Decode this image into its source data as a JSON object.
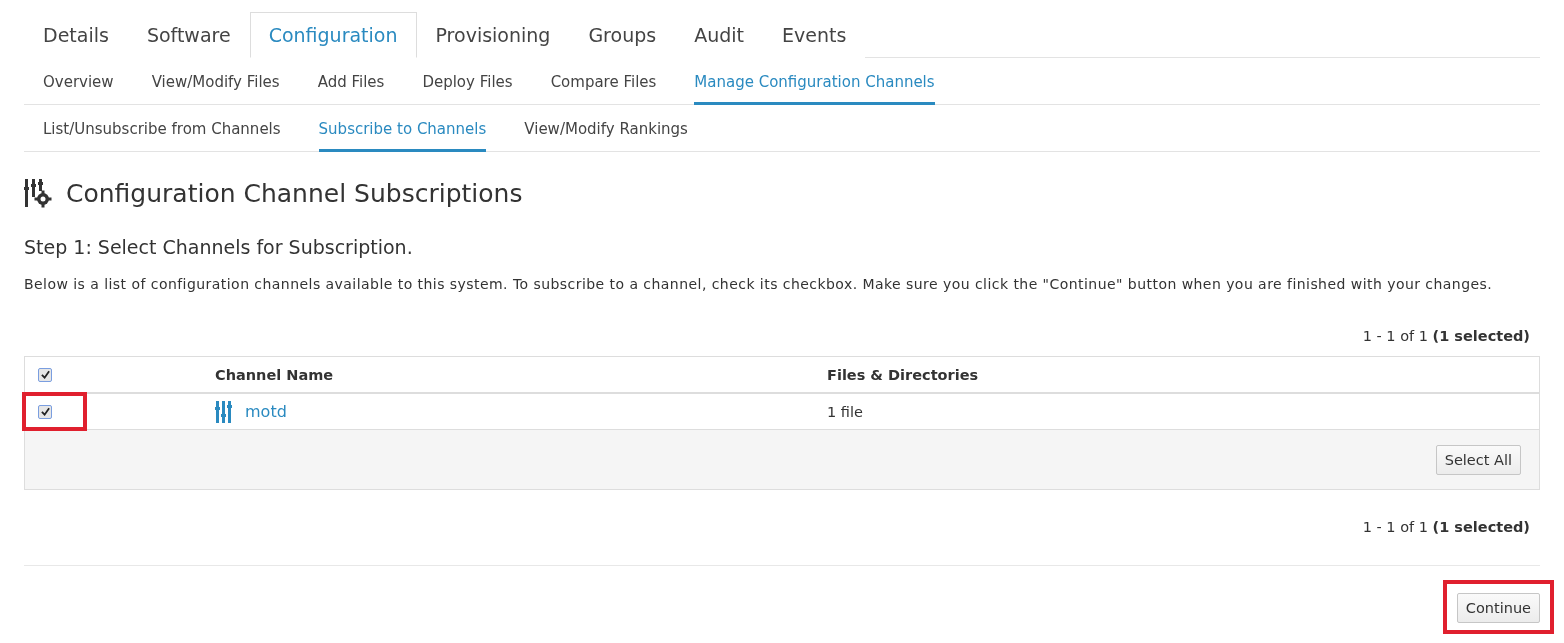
{
  "main_tabs": [
    {
      "label": "Details",
      "selected": false
    },
    {
      "label": "Software",
      "selected": false
    },
    {
      "label": "Configuration",
      "selected": true
    },
    {
      "label": "Provisioning",
      "selected": false
    },
    {
      "label": "Groups",
      "selected": false
    },
    {
      "label": "Audit",
      "selected": false
    },
    {
      "label": "Events",
      "selected": false
    }
  ],
  "sub_tabs": [
    {
      "label": "Overview",
      "selected": false
    },
    {
      "label": "View/Modify Files",
      "selected": false
    },
    {
      "label": "Add Files",
      "selected": false
    },
    {
      "label": "Deploy Files",
      "selected": false
    },
    {
      "label": "Compare Files",
      "selected": false
    },
    {
      "label": "Manage Configuration Channels",
      "selected": true
    }
  ],
  "third_tabs": [
    {
      "label": "List/Unsubscribe from Channels",
      "selected": false
    },
    {
      "label": "Subscribe to Channels",
      "selected": true
    },
    {
      "label": "View/Modify Rankings",
      "selected": false
    }
  ],
  "heading": "Configuration Channel Subscriptions",
  "step_title": "Step 1: Select Channels for Subscription.",
  "description": "Below is a list of configuration channels available to this system. To subscribe to a channel, check its checkbox. Make sure you click the \"Continue\" button when you are finished with your changes.",
  "pager_top": "1 - 1 of 1 **(1 selected)**",
  "table": {
    "header_checked": true,
    "columns": [
      "Channel Name",
      "Files & Directories"
    ],
    "rows": [
      {
        "checked": true,
        "highlighted": true,
        "name": "motd",
        "files": "1 file"
      }
    ]
  },
  "select_all": "Select All",
  "pager_bottom": "1 - 1 of 1 **(1 selected)**",
  "continue_button": {
    "label": "Continue",
    "highlighted": true
  }
}
